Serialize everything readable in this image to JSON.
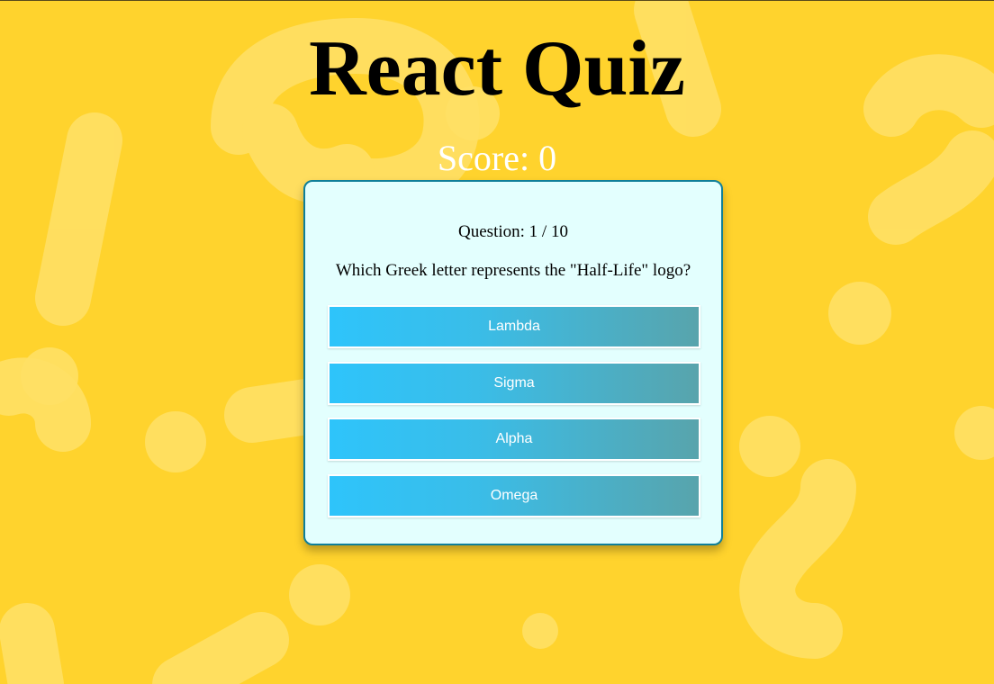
{
  "app": {
    "title": "React Quiz",
    "score_text": "Score: 0"
  },
  "question": {
    "progress_text": "Question: 1 / 10",
    "current": 1,
    "total": 10,
    "text": "Which Greek letter represents the \"Half-Life\" logo?"
  },
  "answers": [
    {
      "label": "Lambda"
    },
    {
      "label": "Sigma"
    },
    {
      "label": "Alpha"
    },
    {
      "label": "Omega"
    }
  ],
  "colors": {
    "background": "#ffd32d",
    "decoration": "#ffe065",
    "card_background": "#e3fffe",
    "card_border": "#0f7f99",
    "button_gradient_start": "#2ec4fb",
    "button_gradient_end": "#58a4ac",
    "score_text": "#ffffff"
  }
}
